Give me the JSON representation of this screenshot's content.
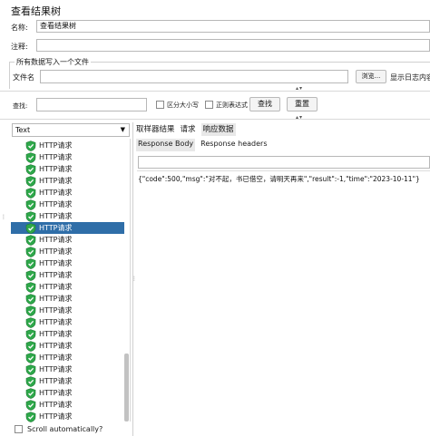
{
  "window": {
    "title": "查看结果树"
  },
  "form": {
    "name_label": "名称:",
    "name_value": "查看结果树",
    "comment_label": "注释:",
    "comment_value": "",
    "group_title": "所有数据写入一个文件",
    "filename_label": "文件名",
    "filename_value": "",
    "browse_button": "浏览...",
    "log_label": "显示日志内容"
  },
  "search": {
    "label": "查找:",
    "value": "",
    "case_sensitive": {
      "label": "区分大小写",
      "checked": false
    },
    "regex": {
      "label": "正则表达式",
      "checked": false
    },
    "find_button": "查找",
    "reset_button": "重置"
  },
  "renderer": {
    "selected": "Text"
  },
  "tree": {
    "items": [
      {
        "label": "HTTP请求",
        "selected": false
      },
      {
        "label": "HTTP请求",
        "selected": false
      },
      {
        "label": "HTTP请求",
        "selected": false
      },
      {
        "label": "HTTP请求",
        "selected": false
      },
      {
        "label": "HTTP请求",
        "selected": false
      },
      {
        "label": "HTTP请求",
        "selected": false
      },
      {
        "label": "HTTP请求",
        "selected": false
      },
      {
        "label": "HTTP请求",
        "selected": true
      },
      {
        "label": "HTTP请求",
        "selected": false
      },
      {
        "label": "HTTP请求",
        "selected": false
      },
      {
        "label": "HTTP请求",
        "selected": false
      },
      {
        "label": "HTTP请求",
        "selected": false
      },
      {
        "label": "HTTP请求",
        "selected": false
      },
      {
        "label": "HTTP请求",
        "selected": false
      },
      {
        "label": "HTTP请求",
        "selected": false
      },
      {
        "label": "HTTP请求",
        "selected": false
      },
      {
        "label": "HTTP请求",
        "selected": false
      },
      {
        "label": "HTTP请求",
        "selected": false
      },
      {
        "label": "HTTP请求",
        "selected": false
      },
      {
        "label": "HTTP请求",
        "selected": false
      },
      {
        "label": "HTTP请求",
        "selected": false
      },
      {
        "label": "HTTP请求",
        "selected": false
      },
      {
        "label": "HTTP请求",
        "selected": false
      },
      {
        "label": "HTTP请求",
        "selected": false
      }
    ],
    "scroll_label": "Scroll automatically?",
    "scroll_checked": false
  },
  "tabs": {
    "main": [
      "取样器结果",
      "请求",
      "响应数据"
    ],
    "sub": [
      "Response Body",
      "Response headers"
    ]
  },
  "response": {
    "body": "{\"code\":500,\"msg\":\"对不起，书已借空，请明天再来\",\"result\":-1,\"time\":\"2023-10-11\"}"
  },
  "colors": {
    "accent": "#2f6ea8",
    "success": "#2ea84a"
  }
}
